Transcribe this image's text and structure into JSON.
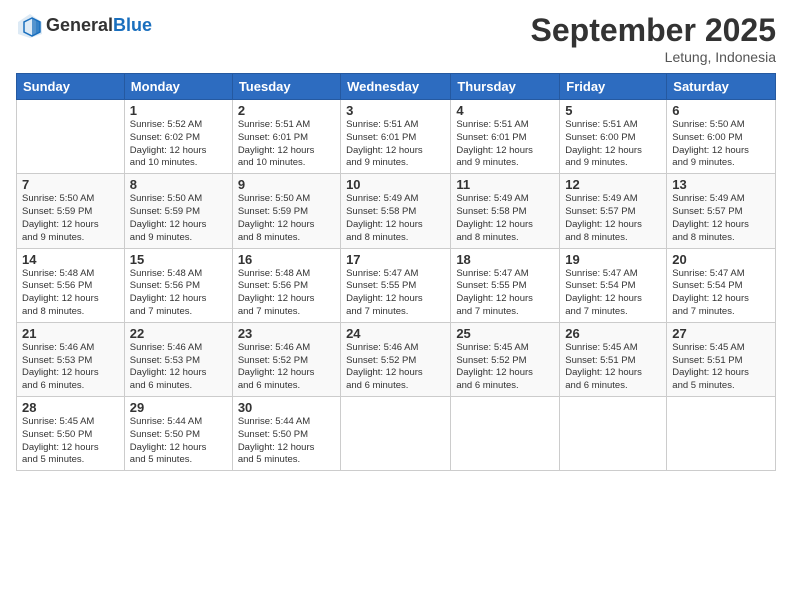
{
  "header": {
    "logo_general": "General",
    "logo_blue": "Blue",
    "month_title": "September 2025",
    "location": "Letung, Indonesia"
  },
  "days_of_week": [
    "Sunday",
    "Monday",
    "Tuesday",
    "Wednesday",
    "Thursday",
    "Friday",
    "Saturday"
  ],
  "weeks": [
    [
      {
        "day": "",
        "info": ""
      },
      {
        "day": "1",
        "info": "Sunrise: 5:52 AM\nSunset: 6:02 PM\nDaylight: 12 hours\nand 10 minutes."
      },
      {
        "day": "2",
        "info": "Sunrise: 5:51 AM\nSunset: 6:01 PM\nDaylight: 12 hours\nand 10 minutes."
      },
      {
        "day": "3",
        "info": "Sunrise: 5:51 AM\nSunset: 6:01 PM\nDaylight: 12 hours\nand 9 minutes."
      },
      {
        "day": "4",
        "info": "Sunrise: 5:51 AM\nSunset: 6:01 PM\nDaylight: 12 hours\nand 9 minutes."
      },
      {
        "day": "5",
        "info": "Sunrise: 5:51 AM\nSunset: 6:00 PM\nDaylight: 12 hours\nand 9 minutes."
      },
      {
        "day": "6",
        "info": "Sunrise: 5:50 AM\nSunset: 6:00 PM\nDaylight: 12 hours\nand 9 minutes."
      }
    ],
    [
      {
        "day": "7",
        "info": "Sunrise: 5:50 AM\nSunset: 5:59 PM\nDaylight: 12 hours\nand 9 minutes."
      },
      {
        "day": "8",
        "info": "Sunrise: 5:50 AM\nSunset: 5:59 PM\nDaylight: 12 hours\nand 9 minutes."
      },
      {
        "day": "9",
        "info": "Sunrise: 5:50 AM\nSunset: 5:59 PM\nDaylight: 12 hours\nand 8 minutes."
      },
      {
        "day": "10",
        "info": "Sunrise: 5:49 AM\nSunset: 5:58 PM\nDaylight: 12 hours\nand 8 minutes."
      },
      {
        "day": "11",
        "info": "Sunrise: 5:49 AM\nSunset: 5:58 PM\nDaylight: 12 hours\nand 8 minutes."
      },
      {
        "day": "12",
        "info": "Sunrise: 5:49 AM\nSunset: 5:57 PM\nDaylight: 12 hours\nand 8 minutes."
      },
      {
        "day": "13",
        "info": "Sunrise: 5:49 AM\nSunset: 5:57 PM\nDaylight: 12 hours\nand 8 minutes."
      }
    ],
    [
      {
        "day": "14",
        "info": "Sunrise: 5:48 AM\nSunset: 5:56 PM\nDaylight: 12 hours\nand 8 minutes."
      },
      {
        "day": "15",
        "info": "Sunrise: 5:48 AM\nSunset: 5:56 PM\nDaylight: 12 hours\nand 7 minutes."
      },
      {
        "day": "16",
        "info": "Sunrise: 5:48 AM\nSunset: 5:56 PM\nDaylight: 12 hours\nand 7 minutes."
      },
      {
        "day": "17",
        "info": "Sunrise: 5:47 AM\nSunset: 5:55 PM\nDaylight: 12 hours\nand 7 minutes."
      },
      {
        "day": "18",
        "info": "Sunrise: 5:47 AM\nSunset: 5:55 PM\nDaylight: 12 hours\nand 7 minutes."
      },
      {
        "day": "19",
        "info": "Sunrise: 5:47 AM\nSunset: 5:54 PM\nDaylight: 12 hours\nand 7 minutes."
      },
      {
        "day": "20",
        "info": "Sunrise: 5:47 AM\nSunset: 5:54 PM\nDaylight: 12 hours\nand 7 minutes."
      }
    ],
    [
      {
        "day": "21",
        "info": "Sunrise: 5:46 AM\nSunset: 5:53 PM\nDaylight: 12 hours\nand 6 minutes."
      },
      {
        "day": "22",
        "info": "Sunrise: 5:46 AM\nSunset: 5:53 PM\nDaylight: 12 hours\nand 6 minutes."
      },
      {
        "day": "23",
        "info": "Sunrise: 5:46 AM\nSunset: 5:52 PM\nDaylight: 12 hours\nand 6 minutes."
      },
      {
        "day": "24",
        "info": "Sunrise: 5:46 AM\nSunset: 5:52 PM\nDaylight: 12 hours\nand 6 minutes."
      },
      {
        "day": "25",
        "info": "Sunrise: 5:45 AM\nSunset: 5:52 PM\nDaylight: 12 hours\nand 6 minutes."
      },
      {
        "day": "26",
        "info": "Sunrise: 5:45 AM\nSunset: 5:51 PM\nDaylight: 12 hours\nand 6 minutes."
      },
      {
        "day": "27",
        "info": "Sunrise: 5:45 AM\nSunset: 5:51 PM\nDaylight: 12 hours\nand 5 minutes."
      }
    ],
    [
      {
        "day": "28",
        "info": "Sunrise: 5:45 AM\nSunset: 5:50 PM\nDaylight: 12 hours\nand 5 minutes."
      },
      {
        "day": "29",
        "info": "Sunrise: 5:44 AM\nSunset: 5:50 PM\nDaylight: 12 hours\nand 5 minutes."
      },
      {
        "day": "30",
        "info": "Sunrise: 5:44 AM\nSunset: 5:50 PM\nDaylight: 12 hours\nand 5 minutes."
      },
      {
        "day": "",
        "info": ""
      },
      {
        "day": "",
        "info": ""
      },
      {
        "day": "",
        "info": ""
      },
      {
        "day": "",
        "info": ""
      }
    ]
  ]
}
